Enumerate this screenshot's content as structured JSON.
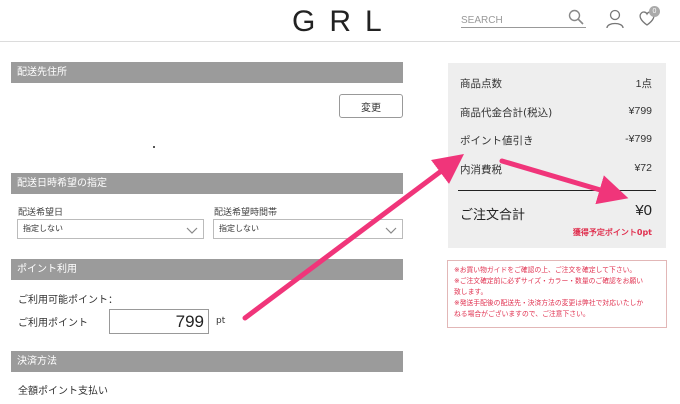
{
  "header": {
    "logo": "GRL",
    "search_placeholder": "SEARCH",
    "cart_count": "0"
  },
  "shipping": {
    "title": "配送先住所",
    "change_label": "変更"
  },
  "delivery": {
    "title": "配送日時希望の指定",
    "date_label": "配送希望日",
    "date_value": "指定しない",
    "time_label": "配送希望時間帯",
    "time_value": "指定しない"
  },
  "points": {
    "title": "ポイント利用",
    "available_label": "ご利用可能ポイント：",
    "use_label": "ご利用ポイント",
    "use_value": "799",
    "unit": "pt"
  },
  "payment": {
    "title": "決済方法",
    "method": "全額ポイント支払い"
  },
  "summary": {
    "rows": [
      {
        "label": "商品点数",
        "value": "1点"
      },
      {
        "label": "商品代金合計(税込)",
        "value": "¥799"
      },
      {
        "label": "ポイント値引き",
        "value": "-¥799"
      },
      {
        "label": "内消費税",
        "value": "¥72"
      }
    ],
    "total_label": "ご注文合計",
    "total_value": "¥0",
    "earn_points": "獲得予定ポイント0pt"
  },
  "notes": [
    "※お買い物ガイドをご確認の上、ご注文を確定して下さい。",
    "※ご注文確定前に必ずサイズ・カラー・数量のご確認をお願い",
    "致します。",
    "※発送手配後の配送先・決済方法の変更は弊社で対応いたしか",
    "ねる場合がございますので、ご注意下さい。"
  ],
  "colors": {
    "section_header": "#9b9b9b",
    "summary_bg": "#eeeeee",
    "accent_red": "#e0304f",
    "arrow": "#f0357a"
  }
}
